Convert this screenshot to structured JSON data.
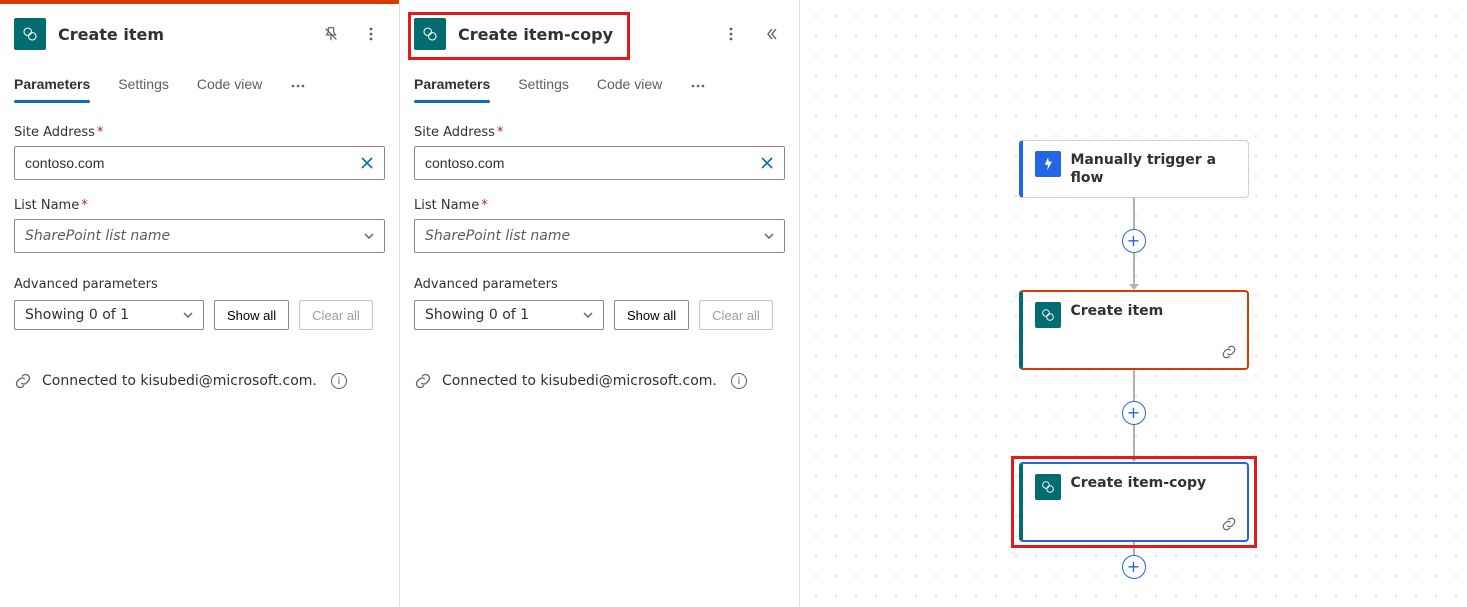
{
  "panels": [
    {
      "title": "Create item",
      "tabs": {
        "parameters": "Parameters",
        "settings": "Settings",
        "code": "Code view"
      },
      "fields": {
        "site_label": "Site Address",
        "site_value": "contoso.com",
        "list_label": "List Name",
        "list_placeholder": "SharePoint list name"
      },
      "advanced": {
        "label": "Advanced parameters",
        "showing": "Showing 0 of 1",
        "show_all": "Show all",
        "clear_all": "Clear all"
      },
      "connected": "Connected to kisubedi@microsoft.com."
    },
    {
      "title": "Create item-copy",
      "tabs": {
        "parameters": "Parameters",
        "settings": "Settings",
        "code": "Code view"
      },
      "fields": {
        "site_label": "Site Address",
        "site_value": "contoso.com",
        "list_label": "List Name",
        "list_placeholder": "SharePoint list name"
      },
      "advanced": {
        "label": "Advanced parameters",
        "showing": "Showing 0 of 1",
        "show_all": "Show all",
        "clear_all": "Clear all"
      },
      "connected": "Connected to kisubedi@microsoft.com."
    }
  ],
  "flow": {
    "trigger": "Manually trigger a flow",
    "action1": "Create item",
    "action2": "Create item-copy"
  },
  "colors": {
    "accent_orange": "#d83b01",
    "accent_blue": "#0f6cbd",
    "sp_teal": "#036c70",
    "callout_red": "#e21b1b"
  }
}
